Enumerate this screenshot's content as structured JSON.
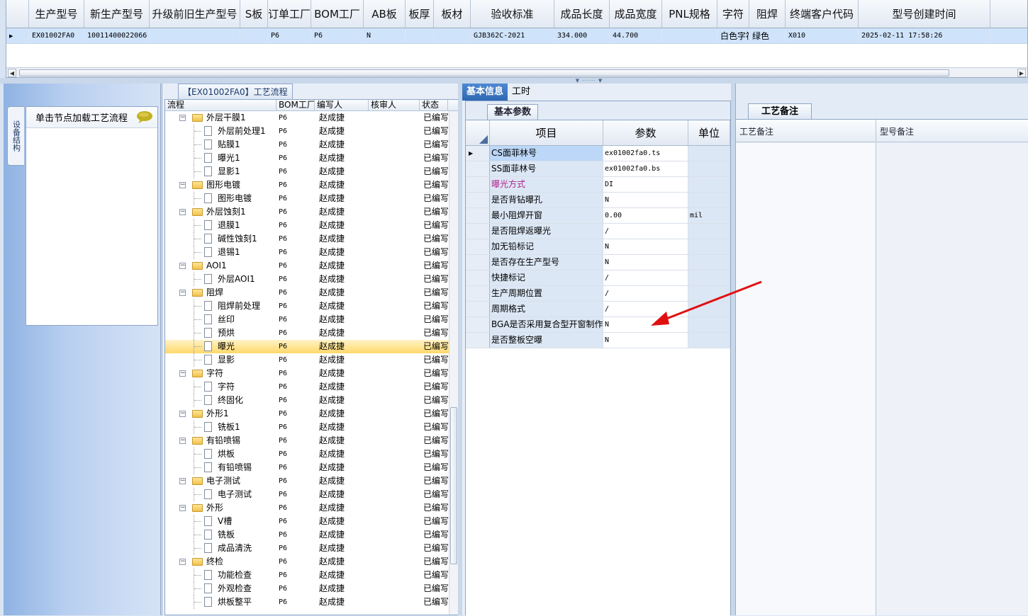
{
  "top_grid": {
    "columns": [
      "生产型号",
      "新生产型号",
      "升级前旧生产型号",
      "S板",
      "订单工厂",
      "BOM工厂",
      "AB板",
      "板厚",
      "板材",
      "验收标准",
      "成品长度",
      "成品宽度",
      "PNL规格",
      "字符",
      "阻焊",
      "终端客户代码",
      "型号创建时间"
    ],
    "row": [
      "EX01002FA0",
      "10011400022066",
      "",
      "",
      "P6",
      "P6",
      "N",
      "",
      "",
      "GJB362C-2021",
      "334.000",
      "44.700",
      "",
      "白色字符",
      "绿色",
      "X010",
      "2025-02-11 17:58:26"
    ]
  },
  "left_panel": {
    "vertical_tab": "设备结构",
    "hint": "单击节点加载工艺流程"
  },
  "tree_panel": {
    "tab_title": "【EX01002FA0】工艺流程",
    "columns": [
      "流程",
      "BOM工厂",
      "编写人",
      "核审人",
      "状态"
    ],
    "rows": [
      {
        "level": 0,
        "name": "外层干膜1",
        "bom": "P6",
        "writer": "赵成捷",
        "status": "已编写"
      },
      {
        "level": 1,
        "name": "外层前处理1",
        "bom": "P6",
        "writer": "赵成捷",
        "status": "已编写"
      },
      {
        "level": 1,
        "name": "贴膜1",
        "bom": "P6",
        "writer": "赵成捷",
        "status": "已编写"
      },
      {
        "level": 1,
        "name": "曝光1",
        "bom": "P6",
        "writer": "赵成捷",
        "status": "已编写"
      },
      {
        "level": 1,
        "name": "显影1",
        "bom": "P6",
        "writer": "赵成捷",
        "status": "已编写"
      },
      {
        "level": 0,
        "name": "图形电镀",
        "bom": "P6",
        "writer": "赵成捷",
        "status": "已编写"
      },
      {
        "level": 1,
        "name": "图形电镀",
        "bom": "P6",
        "writer": "赵成捷",
        "status": "已编写"
      },
      {
        "level": 0,
        "name": "外层蚀刻1",
        "bom": "P6",
        "writer": "赵成捷",
        "status": "已编写"
      },
      {
        "level": 1,
        "name": "退膜1",
        "bom": "P6",
        "writer": "赵成捷",
        "status": "已编写"
      },
      {
        "level": 1,
        "name": "碱性蚀刻1",
        "bom": "P6",
        "writer": "赵成捷",
        "status": "已编写"
      },
      {
        "level": 1,
        "name": "退锡1",
        "bom": "P6",
        "writer": "赵成捷",
        "status": "已编写"
      },
      {
        "level": 0,
        "name": "AOI1",
        "bom": "P6",
        "writer": "赵成捷",
        "status": "已编写"
      },
      {
        "level": 1,
        "name": "外层AOI1",
        "bom": "P6",
        "writer": "赵成捷",
        "status": "已编写"
      },
      {
        "level": 0,
        "name": "阻焊",
        "bom": "P6",
        "writer": "赵成捷",
        "status": "已编写"
      },
      {
        "level": 1,
        "name": "阻焊前处理",
        "bom": "P6",
        "writer": "赵成捷",
        "status": "已编写"
      },
      {
        "level": 1,
        "name": "丝印",
        "bom": "P6",
        "writer": "赵成捷",
        "status": "已编写"
      },
      {
        "level": 1,
        "name": "预烘",
        "bom": "P6",
        "writer": "赵成捷",
        "status": "已编写"
      },
      {
        "level": 1,
        "name": "曝光",
        "bom": "P6",
        "writer": "赵成捷",
        "status": "已编写",
        "selected": true
      },
      {
        "level": 1,
        "name": "显影",
        "bom": "P6",
        "writer": "赵成捷",
        "status": "已编写"
      },
      {
        "level": 0,
        "name": "字符",
        "bom": "P6",
        "writer": "赵成捷",
        "status": "已编写"
      },
      {
        "level": 1,
        "name": "字符",
        "bom": "P6",
        "writer": "赵成捷",
        "status": "已编写"
      },
      {
        "level": 1,
        "name": "终固化",
        "bom": "P6",
        "writer": "赵成捷",
        "status": "已编写"
      },
      {
        "level": 0,
        "name": "外形1",
        "bom": "P6",
        "writer": "赵成捷",
        "status": "已编写"
      },
      {
        "level": 1,
        "name": "铣板1",
        "bom": "P6",
        "writer": "赵成捷",
        "status": "已编写"
      },
      {
        "level": 0,
        "name": "有铅喷锡",
        "bom": "P6",
        "writer": "赵成捷",
        "status": "已编写"
      },
      {
        "level": 1,
        "name": "烘板",
        "bom": "P6",
        "writer": "赵成捷",
        "status": "已编写"
      },
      {
        "level": 1,
        "name": "有铅喷锡",
        "bom": "P6",
        "writer": "赵成捷",
        "status": "已编写"
      },
      {
        "level": 0,
        "name": "电子测试",
        "bom": "P6",
        "writer": "赵成捷",
        "status": "已编写"
      },
      {
        "level": 1,
        "name": "电子测试",
        "bom": "P6",
        "writer": "赵成捷",
        "status": "已编写"
      },
      {
        "level": 0,
        "name": "外形",
        "bom": "P6",
        "writer": "赵成捷",
        "status": "已编写"
      },
      {
        "level": 1,
        "name": "V槽",
        "bom": "P6",
        "writer": "赵成捷",
        "status": "已编写"
      },
      {
        "level": 1,
        "name": "铣板",
        "bom": "P6",
        "writer": "赵成捷",
        "status": "已编写"
      },
      {
        "level": 1,
        "name": "成品清洗",
        "bom": "P6",
        "writer": "赵成捷",
        "status": "已编写"
      },
      {
        "level": 0,
        "name": "终检",
        "bom": "P6",
        "writer": "赵成捷",
        "status": "已编写"
      },
      {
        "level": 1,
        "name": "功能检查",
        "bom": "P6",
        "writer": "赵成捷",
        "status": "已编写"
      },
      {
        "level": 1,
        "name": "外观检查",
        "bom": "P6",
        "writer": "赵成捷",
        "status": "已编写"
      },
      {
        "level": 1,
        "name": "烘板整平",
        "bom": "P6",
        "writer": "赵成捷",
        "status": "已编写"
      }
    ]
  },
  "mid_panel": {
    "tabs": [
      "基本信息",
      "工时"
    ],
    "subtab": "基本参数",
    "columns": [
      "项目",
      "参数",
      "单位"
    ],
    "params": [
      {
        "item": "CS面菲林号",
        "value": "ex01002fa0.ts",
        "unit": ""
      },
      {
        "item": "SS面菲林号",
        "value": "ex01002fa0.bs",
        "unit": ""
      },
      {
        "item": "曝光方式",
        "value": "DI",
        "unit": "",
        "color": "#b0248e"
      },
      {
        "item": "是否背钻曝孔",
        "value": "N",
        "unit": ""
      },
      {
        "item": "最小阻焊开窗",
        "value": "0.00",
        "unit": "mil"
      },
      {
        "item": "是否阻焊返曝光",
        "value": "/",
        "unit": ""
      },
      {
        "item": "加无铅标记",
        "value": "N",
        "unit": ""
      },
      {
        "item": "是否存在生产型号",
        "value": "N",
        "unit": ""
      },
      {
        "item": "快捷标记",
        "value": "/",
        "unit": ""
      },
      {
        "item": "生产周期位置",
        "value": "/",
        "unit": ""
      },
      {
        "item": "周期格式",
        "value": "/",
        "unit": ""
      },
      {
        "item": "BGA是否采用复合型开窗制作",
        "value": "N",
        "unit": ""
      },
      {
        "item": "是否整板空曝",
        "value": "N",
        "unit": ""
      }
    ]
  },
  "right_panel": {
    "subtab": "工艺备注",
    "columns": [
      "工艺备注",
      "型号备注"
    ]
  },
  "colors": {
    "accent": "#2f67b3",
    "selected_row": "#ffd86a",
    "arrow": "#e01010"
  }
}
